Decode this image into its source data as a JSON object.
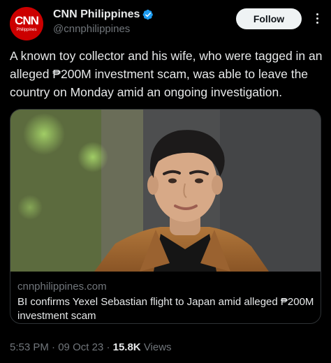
{
  "author": {
    "display_name": "CNN Philippines",
    "handle": "@cnnphilippines",
    "avatar_text": "CNN",
    "avatar_subtext": "Philippines",
    "verified": true
  },
  "actions": {
    "follow_label": "Follow"
  },
  "tweet": {
    "text": "A known toy collector and his wife, who were tagged in an alleged ₱200M investment scam, was able to leave the country on Monday amid an ongoing investigation."
  },
  "card": {
    "domain": "cnnphilippines.com",
    "title": "BI confirms Yexel Sebastian flight to Japan amid alleged ₱200M investment scam"
  },
  "meta": {
    "time": "5:53 PM",
    "date": "09 Oct 23",
    "separator": "·",
    "views_count": "15.8K",
    "views_label": "Views"
  },
  "colors": {
    "background": "#000000",
    "text_primary": "#e7e9ea",
    "text_secondary": "#71767b",
    "verified": "#1d9bf0",
    "brand_red": "#cc0000",
    "border": "#2f3336"
  },
  "icons": [
    "verified-badge-icon",
    "more-options-icon"
  ]
}
